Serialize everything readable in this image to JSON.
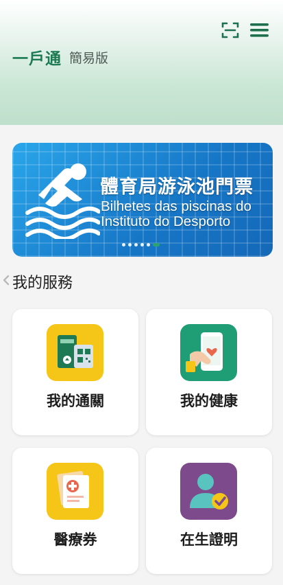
{
  "header": {
    "title": "一戶通",
    "subtitle": "簡易版",
    "scan_icon": "scan-icon",
    "menu_icon": "hamburger-menu-icon",
    "accent_color": "#1b7a52"
  },
  "banner": {
    "title": "體育局游泳池門票",
    "subtitle": "Bilhetes das piscinas do Instituto do Desporto",
    "icon": "swimmer-icon",
    "carousel": {
      "count": 6,
      "active_index": 5
    }
  },
  "services": {
    "section_title": "我的服務",
    "items": [
      {
        "label": "我的通關",
        "icon": "border-crossing-qr-icon",
        "tile_color": "#f5c518"
      },
      {
        "label": "我的健康",
        "icon": "health-phone-icon",
        "tile_color": "#1f9e75"
      },
      {
        "label": "醫療券",
        "icon": "medical-voucher-icon",
        "tile_color": "#f5c518"
      },
      {
        "label": "在生證明",
        "icon": "proof-of-life-icon",
        "tile_color": "#7d4a8c"
      }
    ]
  }
}
